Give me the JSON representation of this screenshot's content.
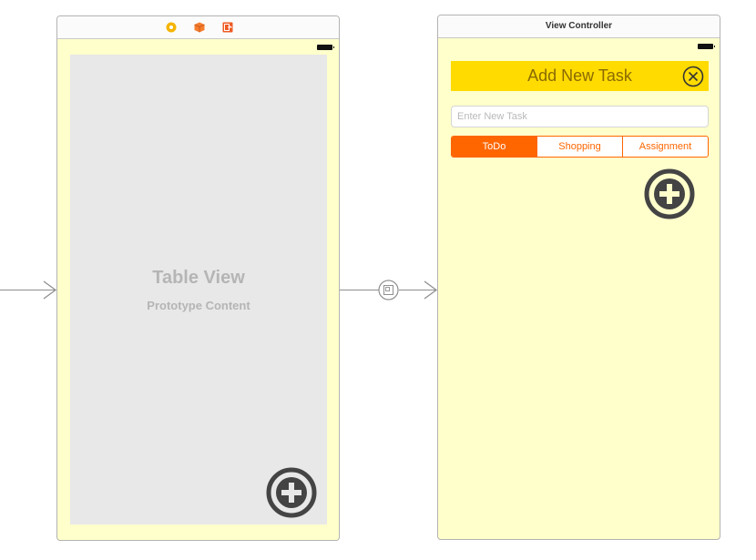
{
  "scene1": {
    "table_view": {
      "title": "Table View",
      "subtitle": "Prototype Content"
    },
    "dock_icons": [
      "view-controller-icon",
      "first-responder-icon",
      "exit-icon"
    ],
    "add_button_icon": "plus-circle-icon"
  },
  "scene2": {
    "title": "View Controller",
    "header": {
      "title": "Add New Task",
      "close_icon": "close-circle-icon"
    },
    "task_input": {
      "value": "",
      "placeholder": "Enter New Task"
    },
    "segments": [
      {
        "label": "ToDo",
        "selected": true
      },
      {
        "label": "Shopping",
        "selected": false
      },
      {
        "label": "Assignment",
        "selected": false
      }
    ],
    "add_button_icon": "plus-circle-icon"
  },
  "colors": {
    "scene_background": "#ffffcc",
    "header_background": "#ffdb00",
    "segment_accent": "#ff6600",
    "table_background": "#e8e8e8",
    "icon_dark": "#444444"
  }
}
